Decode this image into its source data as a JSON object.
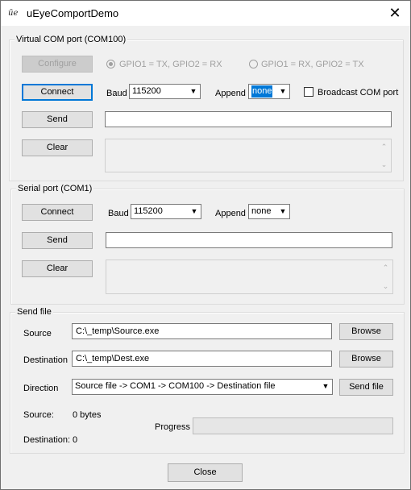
{
  "window": {
    "icon": "ueye-app-icon",
    "icon_glyph": "ūe",
    "title": "uEyeComportDemo",
    "close_glyph": "✕"
  },
  "virtual_com": {
    "group_title": "Virtual COM port (COM100)",
    "configure_label": "Configure",
    "radio1_label": "GPIO1 = TX, GPIO2 = RX",
    "radio1_selected": true,
    "radio2_label": "GPIO1 = RX, GPIO2 = TX",
    "radio2_selected": false,
    "connect_label": "Connect",
    "baud_label": "Baud",
    "baud_value": "115200",
    "append_label": "Append",
    "append_value": "none",
    "broadcast_label": "Broadcast COM port",
    "broadcast_checked": false,
    "send_label": "Send",
    "send_input_value": "",
    "clear_label": "Clear",
    "log_text": ""
  },
  "serial_port": {
    "group_title": "Serial port (COM1)",
    "connect_label": "Connect",
    "baud_label": "Baud",
    "baud_value": "115200",
    "append_label": "Append",
    "append_value": "none",
    "send_label": "Send",
    "send_input_value": "",
    "clear_label": "Clear",
    "log_text": ""
  },
  "send_file": {
    "group_title": "Send file",
    "source_label": "Source",
    "source_value": "C:\\_temp\\Source.exe",
    "browse_label": "Browse",
    "destination_label": "Destination",
    "destination_value": "C:\\_temp\\Dest.exe",
    "direction_label": "Direction",
    "direction_value": "Source file  ->  COM1  ->  COM100  ->  Destination file",
    "send_file_label": "Send file",
    "source_status_label": "Source:",
    "source_status_value": "0 bytes",
    "destination_status_label": "Destination:",
    "destination_status_value": "0",
    "progress_label": "Progress",
    "progress_fraction": 0
  },
  "footer": {
    "close_label": "Close"
  },
  "glyphs": {
    "dropdown": "▼",
    "scroll_up": "⌃",
    "scroll_down": "⌄"
  }
}
